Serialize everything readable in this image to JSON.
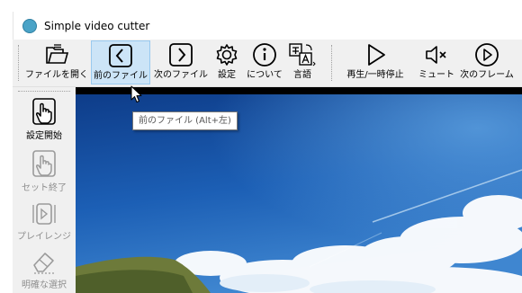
{
  "window": {
    "title": "Simple video cutter"
  },
  "toolbar": {
    "open_file": "ファイルを開く",
    "prev_file": "前のファイル",
    "next_file": "次のファイル",
    "settings": "設定",
    "about": "について",
    "language": "言語",
    "play_pause": "再生/一時停止",
    "mute": "ミュート",
    "next_frame": "次のフレーム"
  },
  "sidebar": {
    "set_start": "設定開始",
    "set_end": "セット終了",
    "play_range": "プレイレンジ",
    "clear_selection": "明確な選択"
  },
  "tooltip": {
    "text": "前のファイル (Alt+左)"
  },
  "colors": {
    "accent_active": "#cce4f7",
    "accent_border": "#99c9ef",
    "sky": "#1c5fb5"
  }
}
